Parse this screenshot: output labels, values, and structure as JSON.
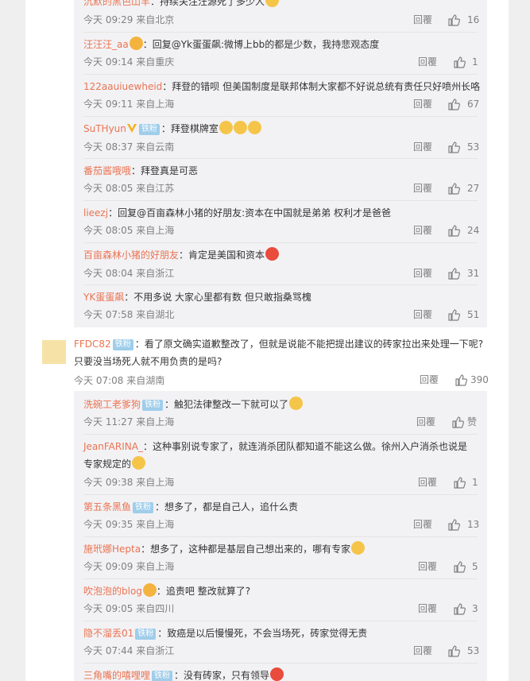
{
  "reply_top": [
    {
      "user": "沉默的黑色山羊",
      "text": "：持续关注汪源死了多少人",
      "emoji": "yellow",
      "meta": "今天 09:29 来自北京",
      "reply_label": "回覆",
      "likes": "16"
    },
    {
      "user": "汪汪汪_aa",
      "text": "：回复@Yk蛋蛋飙:微博上bb的都是少数，我持悲观态度",
      "vip": true,
      "meta": "今天 09:14 来自重庆",
      "reply_label": "回覆",
      "likes": "1"
    },
    {
      "user": "122aauiuewheid",
      "text": "：拜登的错呗 但美国制度是联邦体制大家都不好说总统有责任只好喷州长咯",
      "meta": "今天 09:11 来自上海",
      "reply_label": "回覆",
      "likes": "67"
    },
    {
      "user": "SuTHyun",
      "badge": "铁粉",
      "verified": true,
      "text": "：拜登棋牌室",
      "emojis": 3,
      "meta": "今天 08:37 来自云南",
      "reply_label": "回覆",
      "likes": "53"
    },
    {
      "user": "番茄酱哦哦",
      "text": "：拜登真是可恶",
      "meta": "今天 08:05 来自江苏",
      "reply_label": "回覆",
      "likes": "27"
    },
    {
      "user": "lieezj",
      "text": "：回复@百亩森林小猪的好朋友:资本在中国就是弟弟 权利才是爸爸",
      "meta": "今天 08:05 来自上海",
      "reply_label": "回覆",
      "likes": "24"
    },
    {
      "user": "百亩森林小猪的好朋友",
      "text": "：肯定是美国和资本",
      "emoji": "red",
      "meta": "今天 08:04 来自浙江",
      "reply_label": "回覆",
      "likes": "31"
    },
    {
      "user": "YK蛋蛋飙",
      "text": "：不用多说 大家心里都有数 但只敢指桑骂槐",
      "meta": "今天 07:58 来自湖北",
      "reply_label": "回覆",
      "likes": "51"
    }
  ],
  "main_comment": {
    "user": "FFDC82",
    "badge": "铁粉",
    "text_line1": "：看了原文确实道歉整改了，但就是说能不能把提出建议的砖家拉出来处理一下呢?",
    "text_line2": "只要没当场死人就不用负责的是吗?",
    "meta": "今天 07:08 来自湖南",
    "reply_label": "回覆",
    "likes": "390"
  },
  "reply_bottom": [
    {
      "user": "洗碗工老爹狗",
      "badge": "铁粉",
      "text": "：触犯法律整改一下就可以了",
      "emoji": "yellow",
      "meta": "今天 11:27 来自上海",
      "reply_label": "回覆",
      "likes": "赞"
    },
    {
      "user": "JeanFARINA_",
      "text": "：这种事别说专家了，就连消杀团队都知道不能这么做。徐州入户消杀也说是",
      "text2": "专家规定的",
      "emoji": "yellow",
      "meta": "今天 09:38 来自上海",
      "reply_label": "回覆",
      "likes": "1"
    },
    {
      "user": "第五条黑鱼",
      "badge": "铁粉",
      "text": "：想多了，都是自己人，追什么责",
      "meta": "今天 09:35 来自上海",
      "reply_label": "回覆",
      "likes": "13"
    },
    {
      "user": "施玳娜Hepta",
      "text": "：想多了，这种都是基层自己想出来的，哪有专家",
      "emoji": "yellow",
      "meta": "今天 09:09 来自上海",
      "reply_label": "回覆",
      "likes": "5"
    },
    {
      "user": "吹泡泡的blog",
      "vip": true,
      "text": "：追责吧 整改就算了?",
      "meta": "今天 09:05 来自四川",
      "reply_label": "回覆",
      "likes": "3"
    },
    {
      "user": "隐不溜丢01",
      "badge": "铁粉",
      "text": "：致癌是以后慢慢死，不会当场死，砖家觉得无责",
      "meta": "今天 07:44 来自浙江",
      "reply_label": "回覆",
      "likes": "53"
    },
    {
      "user": "三角嘴的嘻哩哩",
      "badge": "铁粉",
      "text": "：没有砖家，只有领导",
      "emoji": "red"
    }
  ]
}
